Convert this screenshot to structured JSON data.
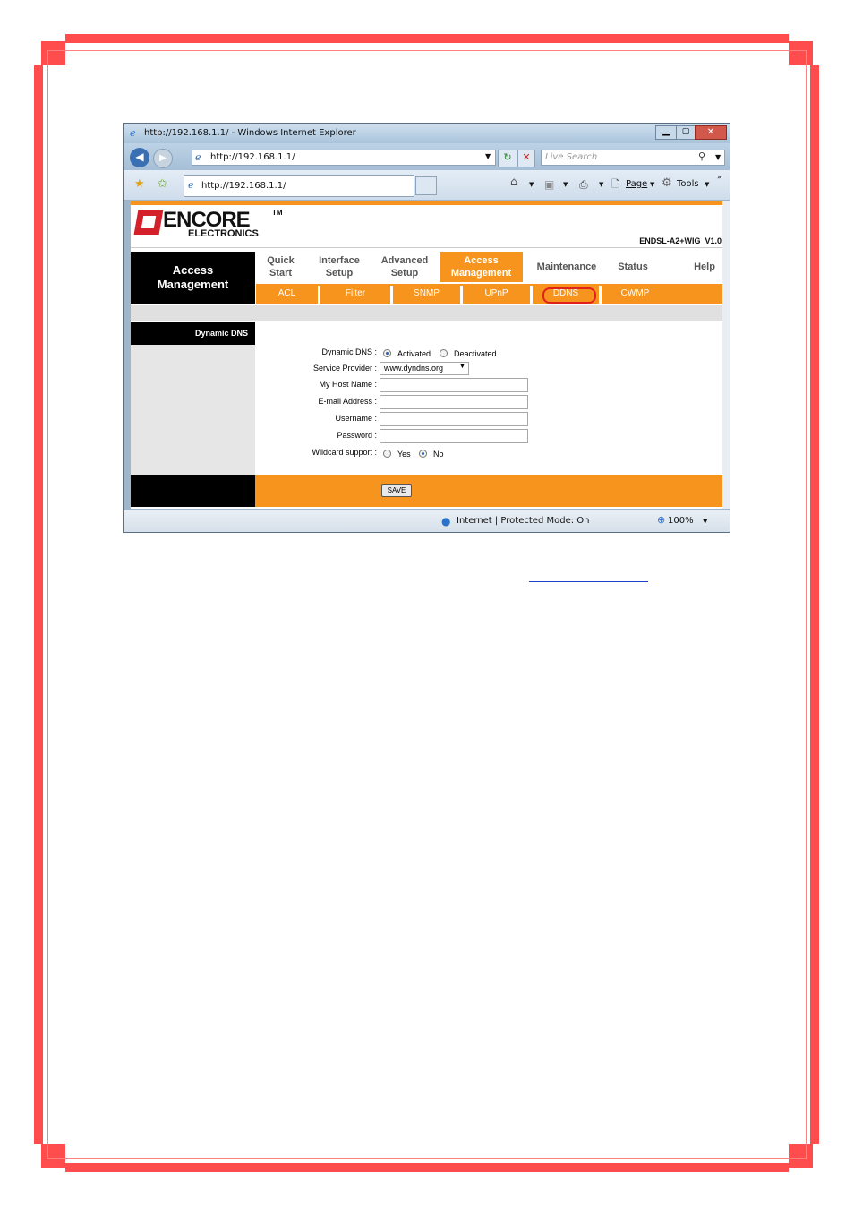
{
  "browser": {
    "window_title": "http://192.168.1.1/ - Windows Internet Explorer",
    "address": "http://192.168.1.1/",
    "search_placeholder": "Live Search",
    "tab_label": "http://192.168.1.1/",
    "page_menu": "Page",
    "tools_menu": "Tools",
    "status_zone": "Internet | Protected Mode: On",
    "zoom": "100%"
  },
  "router": {
    "logo_main": "ENCORE",
    "logo_tm": "TM",
    "logo_sub": "ELECTRONICS",
    "model": "ENDSL-A2+WIG_V1.0",
    "section_title_1": "Access",
    "section_title_2": "Management",
    "nav": [
      {
        "label": "Quick\nStart"
      },
      {
        "label": "Interface\nSetup"
      },
      {
        "label": "Advanced\nSetup"
      },
      {
        "label": "Access\nManagement"
      },
      {
        "label": "Maintenance"
      },
      {
        "label": "Status"
      },
      {
        "label": "Help"
      }
    ],
    "subnav": [
      "ACL",
      "Filter",
      "SNMP",
      "UPnP",
      "DDNS",
      "CWMP"
    ],
    "side_label": "Dynamic DNS",
    "form": {
      "dynamic_dns_label": "Dynamic DNS :",
      "activated": "Activated",
      "deactivated": "Deactivated",
      "provider_label": "Service Provider :",
      "provider_value": "www.dyndns.org",
      "host_label": "My Host Name :",
      "email_label": "E-mail Address :",
      "username_label": "Username :",
      "password_label": "Password :",
      "wildcard_label": "Wildcard support :",
      "yes": "Yes",
      "no": "No",
      "save": "SAVE"
    }
  },
  "colors": {
    "border_red": "#ff4d4d",
    "orange": "#f7941d",
    "dark": "#000000"
  }
}
